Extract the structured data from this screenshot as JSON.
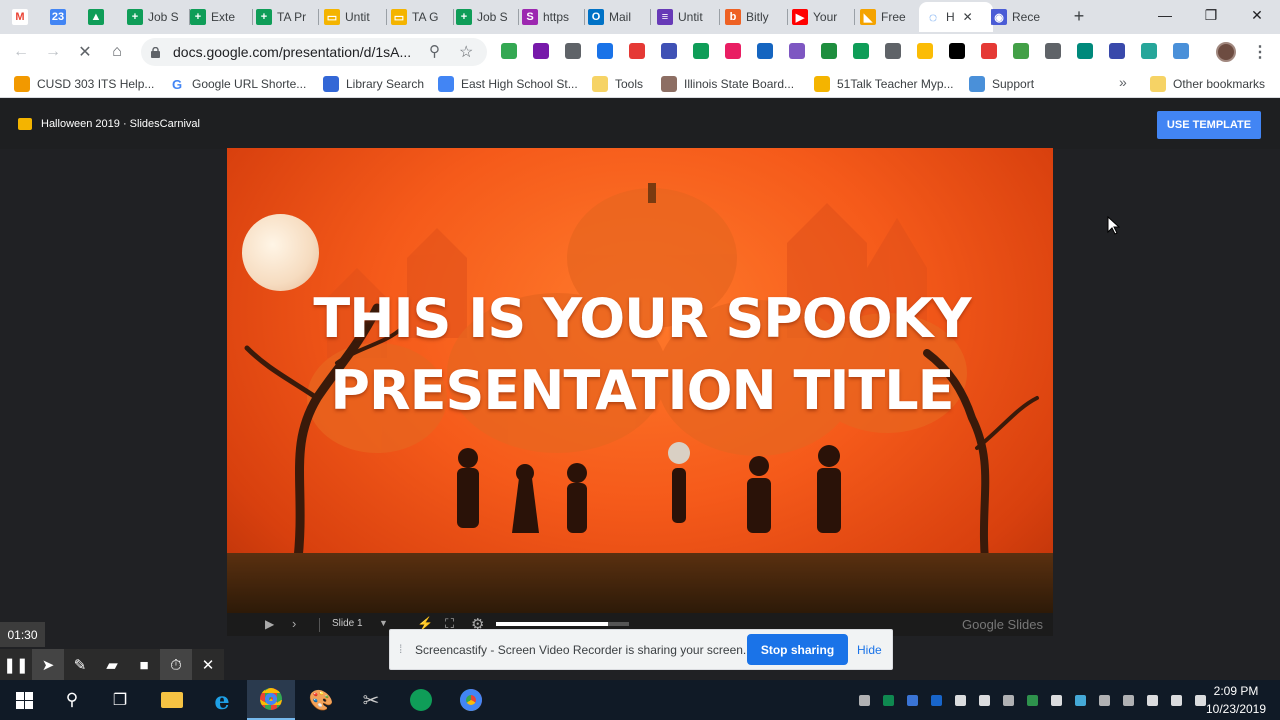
{
  "tabs": [
    {
      "label": "",
      "icon": "gmail-icon",
      "color": "#ea4335",
      "glyph": "M"
    },
    {
      "label": "",
      "icon": "calendar-icon",
      "color": "#4285f4",
      "glyph": "23"
    },
    {
      "label": "",
      "icon": "drive-icon",
      "color": "#0f9d58",
      "glyph": "▲"
    },
    {
      "label": "Job S",
      "icon": "sheets-icon",
      "color": "#0f9d58",
      "glyph": "+"
    },
    {
      "label": "Exte",
      "icon": "sheets-icon",
      "color": "#0f9d58",
      "glyph": "+"
    },
    {
      "label": "TA Pr",
      "icon": "sheets-icon",
      "color": "#0f9d58",
      "glyph": "+"
    },
    {
      "label": "Untit",
      "icon": "slides-icon",
      "color": "#f4b400",
      "glyph": "▭"
    },
    {
      "label": "TA G",
      "icon": "slides-icon",
      "color": "#f4b400",
      "glyph": "▭"
    },
    {
      "label": "Job S",
      "icon": "sheets-icon",
      "color": "#0f9d58",
      "glyph": "+"
    },
    {
      "label": "https",
      "icon": "link-icon",
      "color": "#9c27b0",
      "glyph": "S"
    },
    {
      "label": "Mail",
      "icon": "outlook-icon",
      "color": "#0072c6",
      "glyph": "O"
    },
    {
      "label": "Untit",
      "icon": "forms-icon",
      "color": "#673ab7",
      "glyph": "≡"
    },
    {
      "label": "Bitly",
      "icon": "bitly-icon",
      "color": "#ee6123",
      "glyph": "b"
    },
    {
      "label": "Your",
      "icon": "youtube-icon",
      "color": "#ff0000",
      "glyph": "▶"
    },
    {
      "label": "Free",
      "icon": "slidescarnival-icon",
      "color": "#f4a300",
      "glyph": "◣"
    },
    {
      "label": "H",
      "icon": "loading-icon",
      "color": "#ffffff",
      "glyph": "◌"
    },
    {
      "label": "Rece",
      "icon": "screencastify-icon",
      "color": "#4a5cd6",
      "glyph": "◉"
    }
  ],
  "address": {
    "url": "docs.google.com/presentation/d/1sA..."
  },
  "bookmarks": [
    {
      "label": "CUSD 303 ITS Help...",
      "icon": "lifebuoy-icon",
      "color": "#f29900"
    },
    {
      "label": "Google URL Shorte...",
      "icon": "google-icon",
      "color": "#4285f4"
    },
    {
      "label": "Library Search",
      "icon": "library-icon",
      "color": "#3367d6"
    },
    {
      "label": "East High School St...",
      "icon": "calendar-icon",
      "color": "#4285f4"
    },
    {
      "label": "Tools",
      "icon": "folder-icon",
      "color": "#f6d365"
    },
    {
      "label": "Illinois State Board...",
      "icon": "seal-icon",
      "color": "#8d6e63"
    },
    {
      "label": "51Talk Teacher Myp...",
      "icon": "talk-icon",
      "color": "#f4b400"
    },
    {
      "label": "Support",
      "icon": "support-icon",
      "color": "#4a90d9"
    }
  ],
  "bookmarks_more": "»",
  "other_bookmarks": "Other bookmarks",
  "slides_header": {
    "title": "Halloween 2019 · SlidesCarnival",
    "use_template": "USE TEMPLATE"
  },
  "slide": {
    "title_line1": "THIS IS YOUR SPOOKY",
    "title_line2": "PRESENTATION TITLE"
  },
  "player": {
    "slide_label": "Slide 1",
    "brand": "Google Slides"
  },
  "recorder": {
    "timer": "01:30"
  },
  "share_bar": {
    "message": "Screencastify - Screen Video Recorder is sharing your screen.",
    "stop": "Stop sharing",
    "hide": "Hide"
  },
  "taskbar": {
    "time": "2:09 PM",
    "date": "10/23/2019"
  },
  "colors": {
    "accent": "#4285f4",
    "slide_orange": "#f55a1a",
    "taskbar": "#101a26"
  }
}
